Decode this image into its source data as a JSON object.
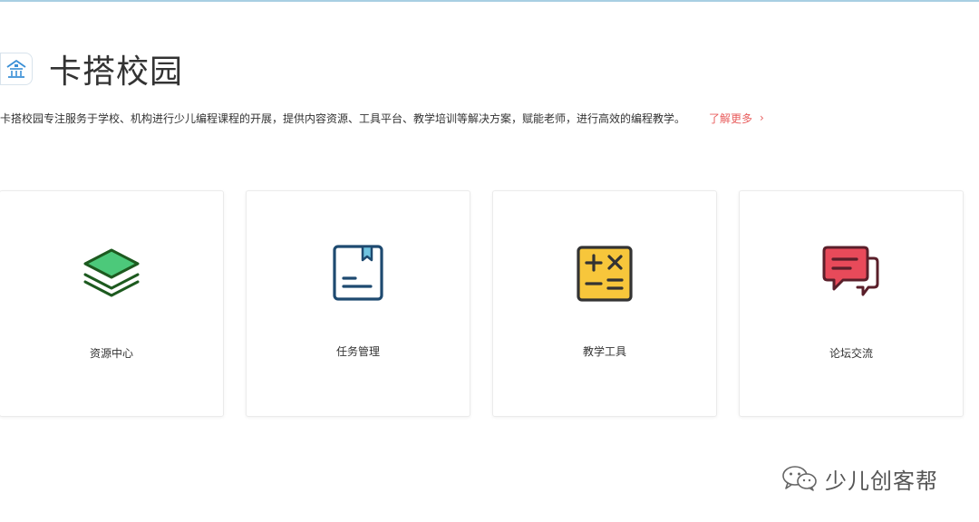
{
  "header": {
    "logo_icon": "school-building-icon",
    "title": "卡搭校园"
  },
  "intro": {
    "description": "卡搭校园专注服务于学校、机构进行少儿编程课程的开展，提供内容资源、工具平台、教学培训等解决方案，赋能老师，进行高效的编程教学。",
    "learn_more": "了解更多",
    "learn_more_color": "#e85d5d"
  },
  "cards": [
    {
      "label": "资源中心",
      "icon": "layers-icon",
      "color": "#4cc97a"
    },
    {
      "label": "任务管理",
      "icon": "bookmark-document-icon",
      "color": "#1e4a70"
    },
    {
      "label": "教学工具",
      "icon": "calculator-icon",
      "color": "#f7c63b"
    },
    {
      "label": "论坛交流",
      "icon": "chat-bubbles-icon",
      "color": "#e84a5a"
    }
  ],
  "watermark": {
    "text": "少儿创客帮",
    "icon": "wechat-icon"
  }
}
